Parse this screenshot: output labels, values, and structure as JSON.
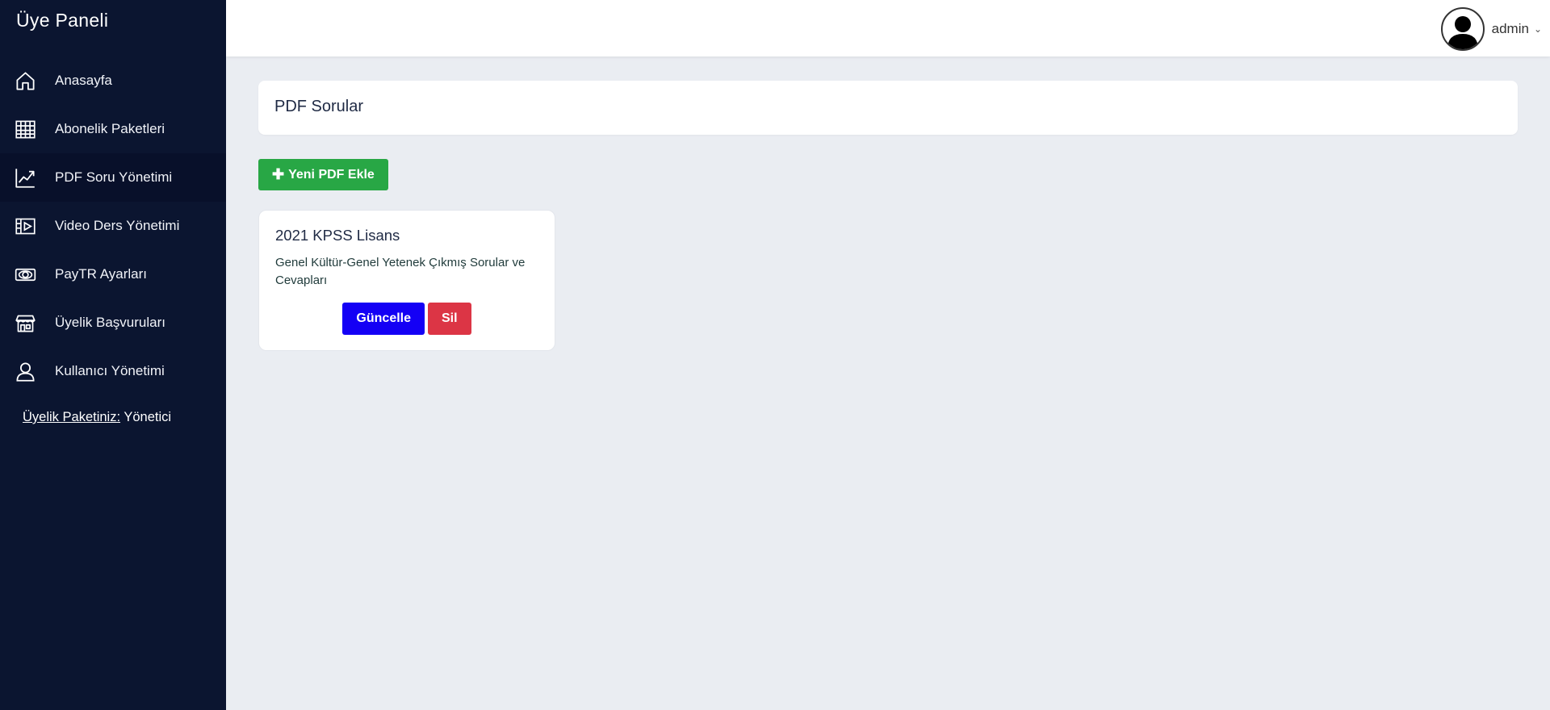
{
  "sidebar": {
    "brand": "Üye Paneli",
    "items": [
      {
        "label": "Anasayfa",
        "icon": "home-icon"
      },
      {
        "label": "Abonelik Paketleri",
        "icon": "table-icon"
      },
      {
        "label": "PDF Soru Yönetimi",
        "icon": "chart-line-icon",
        "active": true
      },
      {
        "label": "Video Ders Yönetimi",
        "icon": "film-icon"
      },
      {
        "label": "PayTR Ayarları",
        "icon": "money-icon"
      },
      {
        "label": "Üyelik Başvuruları",
        "icon": "store-icon"
      },
      {
        "label": "Kullanıcı Yönetimi",
        "icon": "user-icon"
      }
    ],
    "membership": {
      "key": "Üyelik Paketiniz:",
      "value": "Yönetici"
    }
  },
  "topbar": {
    "username": "admin",
    "avatar_icon": "avatar-silhouette-icon",
    "chevron_icon": "chevron-down-icon"
  },
  "main": {
    "page_title": "PDF Sorular",
    "add_button_label": "Yeni PDF Ekle",
    "cards": [
      {
        "title": "2021 KPSS Lisans",
        "description": "Genel Kültür-Genel Yetenek Çıkmış Sorular ve Cevapları",
        "update_label": "Güncelle",
        "delete_label": "Sil"
      }
    ]
  },
  "colors": {
    "sidebar_bg": "#0b1530",
    "content_bg": "#eaedf2",
    "success": "#28a745",
    "primary": "#1400f5",
    "danger": "#dc3545"
  }
}
